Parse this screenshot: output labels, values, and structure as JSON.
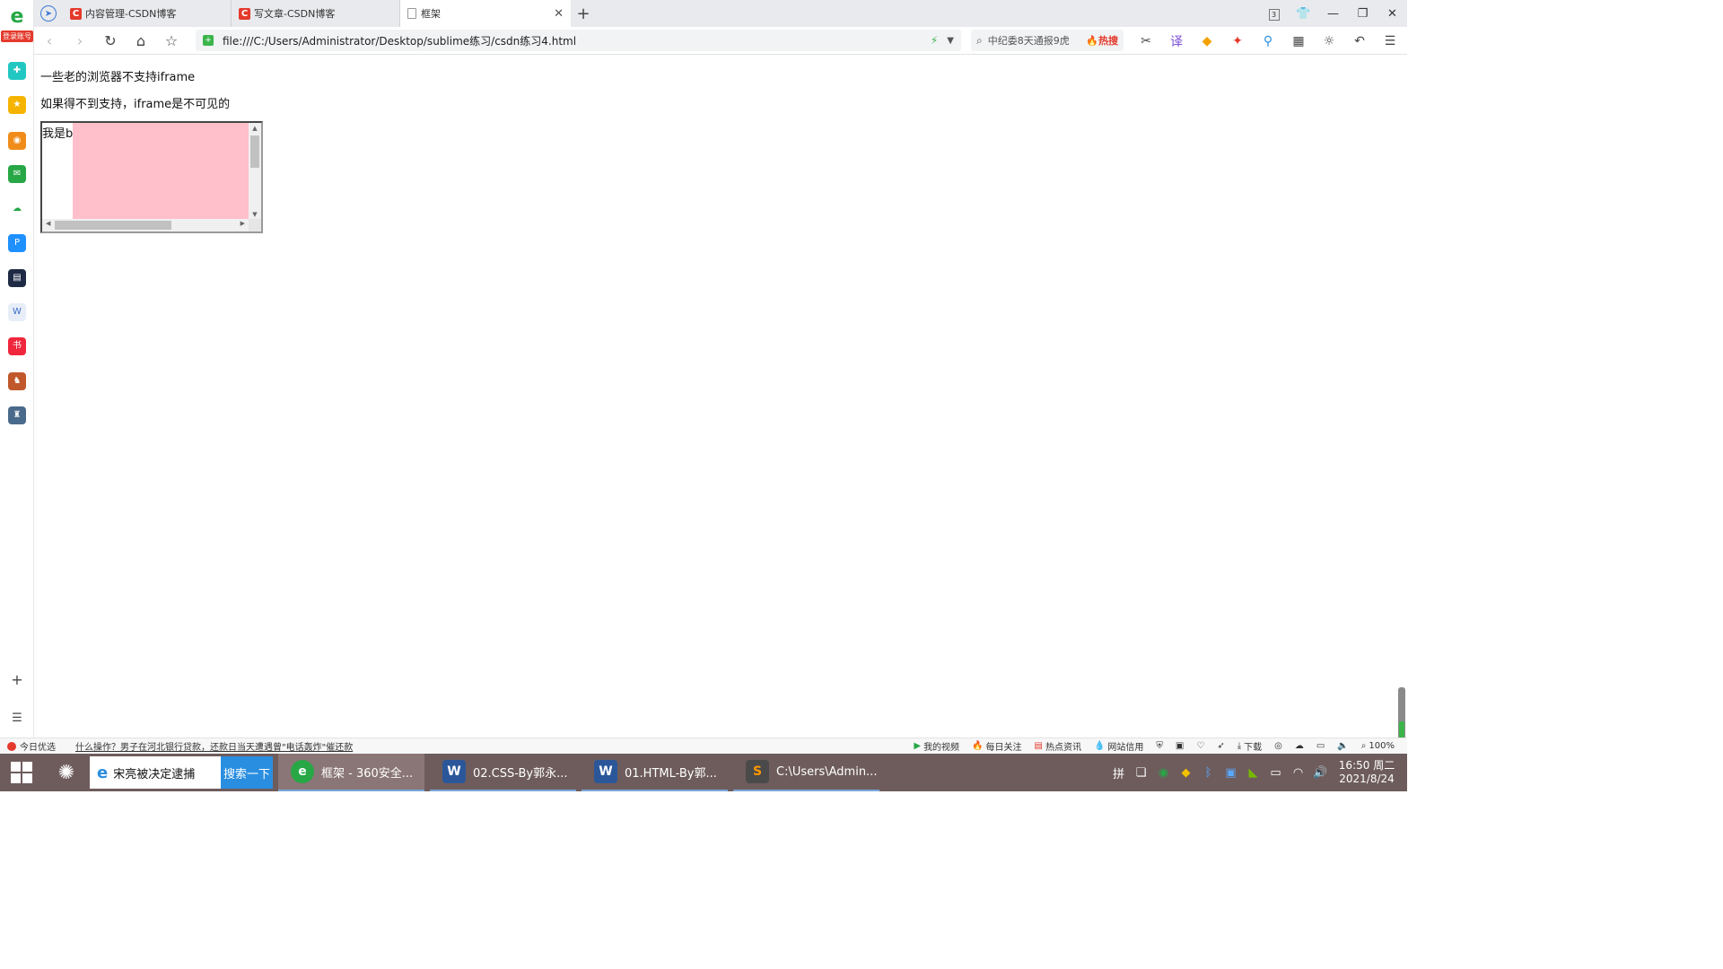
{
  "tabs": [
    {
      "title": "内容管理-CSDN博客",
      "active": false
    },
    {
      "title": "写文章-CSDN博客",
      "active": false
    },
    {
      "title": "框架",
      "active": true
    }
  ],
  "tab_count": "3",
  "address": {
    "url": "file:///C:/Users/Administrator/Desktop/sublime练习/csdn练习4.html"
  },
  "search": {
    "text": "中纪委8天通报9虎",
    "hot_label": "🔥热搜"
  },
  "sidebar": {
    "login_badge": "登录账号"
  },
  "content": {
    "line1": "一些老的浏览器不支持iframe",
    "line2": "如果得不到支持，iframe是不可见的",
    "iframe_text": "我是b",
    "iframe_fill_color": "#ffc0cb"
  },
  "statusbar": {
    "left_label": "今日优选",
    "news": "什么操作？男子在河北银行贷款，还款日当天遭遇曾\"电话轰炸\"催还款",
    "items": [
      "我的视频",
      "每日关注",
      "热点资讯",
      "网站信用",
      "下载",
      "100%"
    ]
  },
  "taskbar": {
    "search_text": "宋亮被决定逮捕",
    "search_button": "搜索一下",
    "tasks": [
      {
        "label": "框架 - 360安全...",
        "active": true
      },
      {
        "label": "02.CSS-By郭永...",
        "active": false
      },
      {
        "label": "01.HTML-By郭...",
        "active": false
      },
      {
        "label": "C:\\Users\\Admin...",
        "active": false
      }
    ],
    "ime": "拼",
    "time": "16:50 周二",
    "date": "2021/8/24"
  }
}
